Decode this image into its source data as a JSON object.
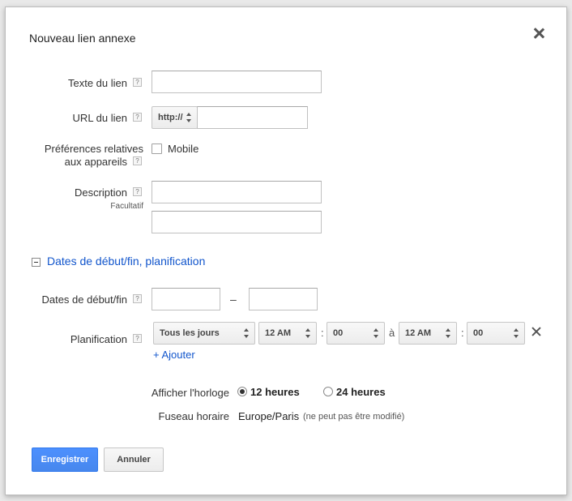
{
  "dialog": {
    "title": "Nouveau lien annexe"
  },
  "form": {
    "link_text": {
      "label": "Texte du lien",
      "help": "?",
      "value": ""
    },
    "link_url": {
      "label": "URL du lien",
      "help": "?",
      "protocol": "http://",
      "value": ""
    },
    "device_prefs": {
      "label_line1": "Préférences relatives",
      "label_line2": "aux appareils",
      "help": "?",
      "checkbox_label": "Mobile",
      "checked": false
    },
    "description": {
      "label": "Description",
      "help": "?",
      "sublabel": "Facultatif",
      "line1": "",
      "line2": ""
    }
  },
  "schedule_section": {
    "title": "Dates de début/fin, planification",
    "dates": {
      "label": "Dates de début/fin",
      "help": "?",
      "separator": "–",
      "start": "",
      "end": ""
    },
    "planning": {
      "label": "Planification",
      "help": "?",
      "day": "Tous les jours",
      "from_hour": "12 AM",
      "from_min": "00",
      "to_word": "à",
      "to_hour": "12 AM",
      "to_min": "00",
      "colon": ":",
      "add_label": "+ Ajouter"
    },
    "clock": {
      "label": "Afficher l'horloge",
      "option_12": "12 heures",
      "option_24": "24 heures",
      "selected": "12 heures"
    },
    "timezone": {
      "label": "Fuseau horaire",
      "value": "Europe/Paris",
      "note": "(ne peut pas être modifié)"
    }
  },
  "buttons": {
    "save": "Enregistrer",
    "cancel": "Annuler"
  },
  "colors": {
    "link": "#1155cc",
    "primary": "#4d90fe"
  }
}
